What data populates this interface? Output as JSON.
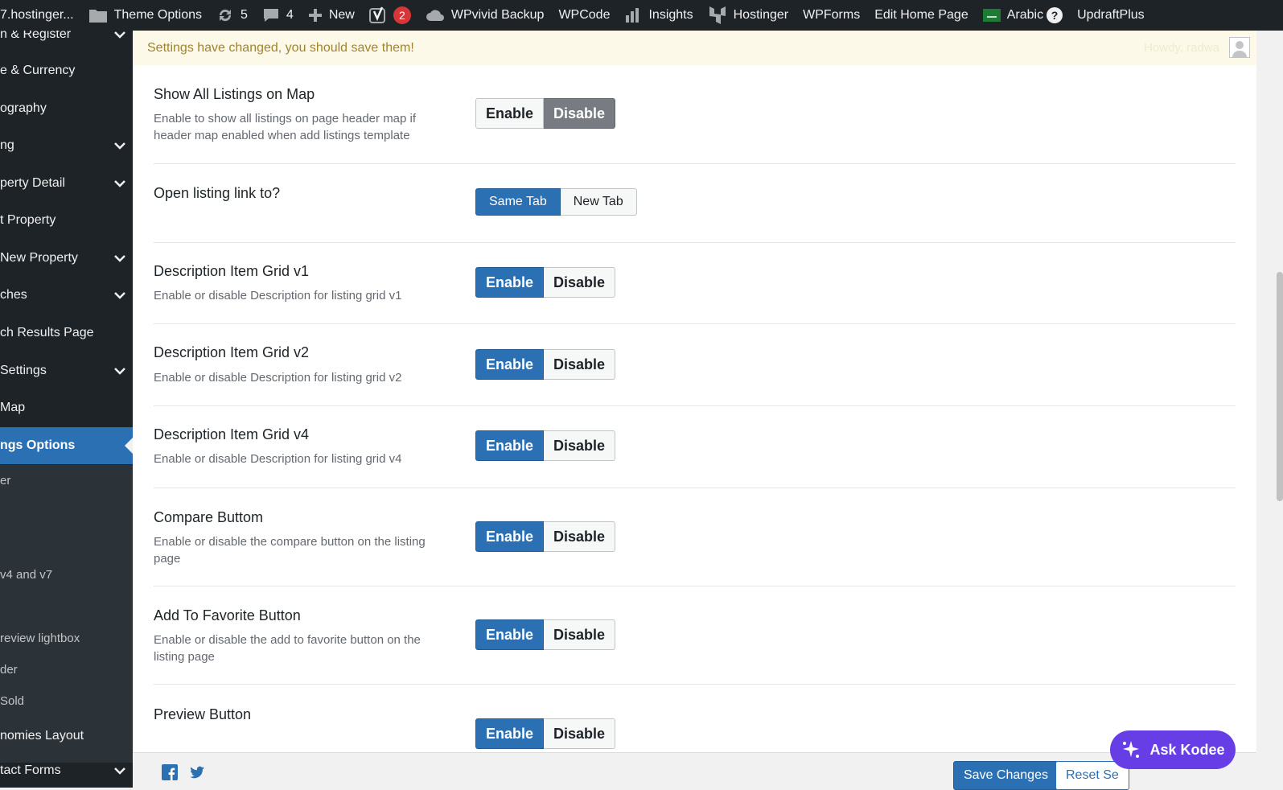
{
  "adminbar": {
    "site": "7.hostinger...",
    "theme_options": "Theme Options",
    "updates_count": "5",
    "comments_count": "4",
    "new_label": "New",
    "yoast_badge": "2",
    "wpvivid": "WPvivid Backup",
    "wpcode": "WPCode",
    "insights": "Insights",
    "hostinger": "Hostinger",
    "wpforms": "WPForms",
    "edit_home": "Edit Home Page",
    "language": "Arabic",
    "language_help": "?",
    "updraft": "UpdraftPlus"
  },
  "sidebar": {
    "items": [
      "n & Register",
      "e & Currency",
      "ography",
      "ng",
      "perty Detail",
      "t Property",
      " New Property",
      "ches",
      "ch Results Page",
      " Settings",
      " Map",
      "ngs Options",
      "nomies Layout",
      "tact Forms"
    ],
    "subitems": [
      "er",
      " v4 and v7",
      "review lightbox",
      "der",
      "Sold"
    ]
  },
  "notice": {
    "message": "Settings have changed, you should save them!",
    "howdy": "Howdy, radwa"
  },
  "settings": [
    {
      "title": "Show All Listings on Map",
      "desc": "Enable to show all listings on page header map if header map enabled when add listings template",
      "opt_a": "Enable",
      "opt_b": "Disable",
      "selected": "Disable"
    },
    {
      "title": "Open listing link to?",
      "desc": "",
      "opt_a": "Same Tab",
      "opt_b": "New Tab",
      "selected": "Same Tab"
    },
    {
      "title": "Description Item Grid v1",
      "desc": "Enable or disable Description for listing grid v1",
      "opt_a": "Enable",
      "opt_b": "Disable",
      "selected": "Enable"
    },
    {
      "title": "Description Item Grid v2",
      "desc": "Enable or disable Description for listing grid v2",
      "opt_a": "Enable",
      "opt_b": "Disable",
      "selected": "Enable"
    },
    {
      "title": "Description Item Grid v4",
      "desc": "Enable or disable Description for listing grid v4",
      "opt_a": "Enable",
      "opt_b": "Disable",
      "selected": "Enable"
    },
    {
      "title": "Compare Buttom",
      "desc": "Enable or disable the compare button on the listing page",
      "opt_a": "Enable",
      "opt_b": "Disable",
      "selected": "Enable"
    },
    {
      "title": "Add To Favorite Button",
      "desc": "Enable or disable the add to favorite button on the listing page",
      "opt_a": "Enable",
      "opt_b": "Disable",
      "selected": "Enable"
    },
    {
      "title": "Preview Button",
      "desc": "",
      "opt_a": "Enable",
      "opt_b": "Disable",
      "selected": "Enable"
    }
  ],
  "footer": {
    "save_label": "Save Changes",
    "reset_label": "Reset Se"
  },
  "kodee": {
    "label": "Ask Kodee"
  },
  "colors": {
    "accent": "#2c70b4",
    "kodee": "#673de6",
    "notice_text": "#a28430"
  }
}
